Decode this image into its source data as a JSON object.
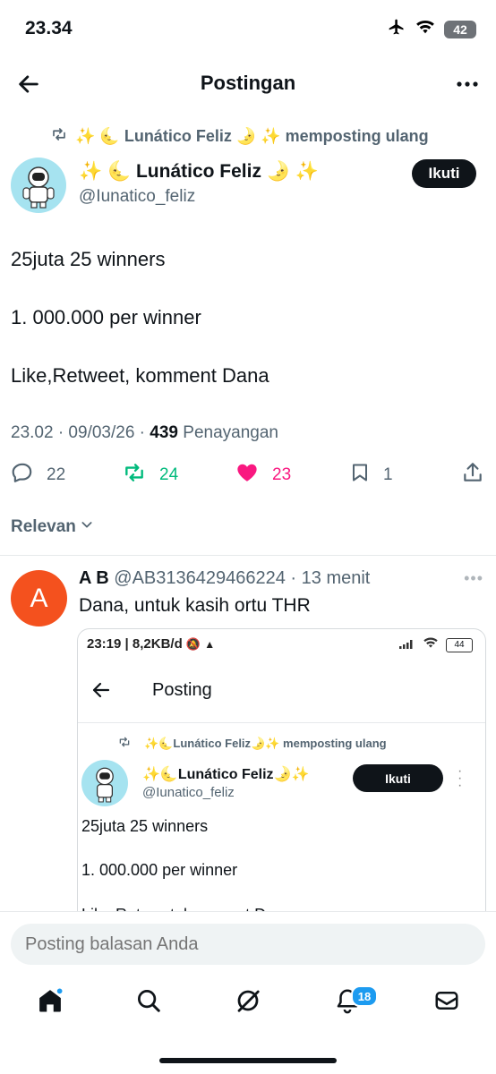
{
  "status": {
    "time": "23.34",
    "battery": "42"
  },
  "header": {
    "title": "Postingan"
  },
  "repost": {
    "text": "✨ 🌜 Lunático Feliz 🌛 ✨ memposting ulang"
  },
  "post": {
    "author_name": "✨ 🌜 Lunático Feliz 🌛 ✨",
    "author_handle": "@Iunatico_feliz",
    "follow_label": "Ikuti",
    "line1": "25juta 25 winners",
    "line2": "1. 000.000 per winner",
    "line3": "Like,Retweet, komment Dana",
    "timestamp": "23.02 · 09/03/26 ·",
    "views_count": "439",
    "views_label": "Penayangan",
    "replies": "22",
    "reposts": "24",
    "likes": "23",
    "bookmarks": "1"
  },
  "sort": {
    "label": "Relevan"
  },
  "reply": {
    "avatar_letter": "A",
    "name": "A B",
    "handle": "@AB3136429466224",
    "time": "· 13 menit",
    "text": "Dana, untuk kasih ortu THR"
  },
  "embed": {
    "status_text": "23:19 | 8,2KB/d",
    "battery": "44",
    "title": "Posting",
    "repost_text": "✨🌜Lunático Feliz🌛✨ memposting ulang",
    "author_name": "✨🌜Lunático Feliz🌛✨",
    "author_handle": "@Iunatico_feliz",
    "follow_label": "Ikuti",
    "line1": "25juta 25 winners",
    "line2": "1. 000.000 per winner",
    "line3": "Like,Retweet, komment Dana"
  },
  "reply_bar": {
    "placeholder": "Posting balasan Anda"
  },
  "nav": {
    "notifications_badge": "18"
  },
  "colors": {
    "accent": "#1d9bf0",
    "repost_green": "#00ba7c",
    "like_pink": "#f91880",
    "text": "#0f1419",
    "muted": "#536471"
  }
}
